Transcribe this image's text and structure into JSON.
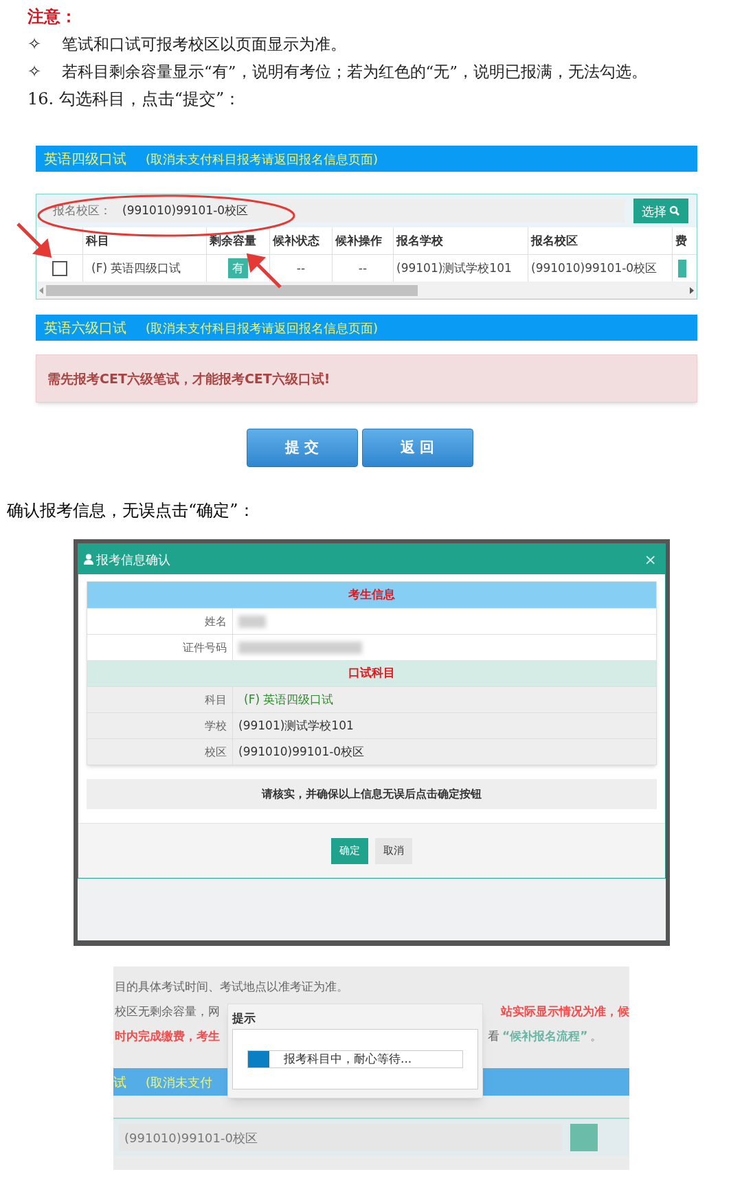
{
  "notes": {
    "heading": "注意：",
    "bullets": [
      {
        "marker": "✧",
        "text": "笔试和口试可报考校区以页面显示为准。"
      },
      {
        "marker": "✧",
        "text": "若科目剩余容量显示“有”，说明有考位；若为红色的“无”，说明已报满，无法勾选。"
      }
    ],
    "step": "16. 勾选科目，点击“提交”："
  },
  "registration": {
    "sections": [
      {
        "kind": "table",
        "title": "英语四级口试",
        "hint": "(取消未支付科目报考请返回报名信息页面)",
        "campus_label": "报名校区：",
        "campus_value": "(991010)99101-0校区",
        "select_button": "选择",
        "columns": [
          "科目",
          "剩余容量",
          "候补状态",
          "候补操作",
          "报名学校",
          "报名校区",
          "费"
        ],
        "rows": [
          {
            "checked": false,
            "subject": "(F) 英语四级口试",
            "capacity": "有",
            "wait_status": "--",
            "wait_action": "--",
            "school": "(99101)测试学校101",
            "campus": "(991010)99101-0校区"
          }
        ]
      },
      {
        "kind": "alert",
        "title": "英语六级口试",
        "hint": "(取消未支付科目报考请返回报名信息页面)",
        "alert": "需先报考CET六级笔试，才能报考CET六级口试!"
      }
    ],
    "buttons": [
      "提 交",
      "返 回"
    ]
  },
  "step_2": "确认报考信息，无误点击“确定”：",
  "dialog": {
    "title": "报考信息确认",
    "close": "×",
    "sections": [
      {
        "heading": "考生信息",
        "rows": [
          {
            "label": "姓名",
            "kind": "redacted"
          },
          {
            "label": "证件号码",
            "kind": "redacted"
          }
        ]
      },
      {
        "heading": "口试科目",
        "rows": [
          {
            "label": "科目",
            "kind": "text",
            "value": "(F) 英语四级口试"
          },
          {
            "label": "学校",
            "kind": "text",
            "value": "(99101)测试学校101"
          },
          {
            "label": "校区",
            "kind": "text",
            "value": "(991010)99101-0校区"
          }
        ]
      }
    ],
    "notice": "请核实，并确保以上信息无误后点击确定按钮",
    "buttons": [
      {
        "label": "确定",
        "primary": true
      },
      {
        "label": "取消",
        "primary": false
      }
    ]
  },
  "background_page": {
    "line_1": "目的具体考试时间、考试地点以准考证为准。",
    "line_2_left": "校区无剩余容量，网",
    "line_2_right": "站实际显示情况为准，候",
    "line_3_left": "时内完成缴费，考生",
    "line_3_right": "看",
    "line_3_link": "“候补报名流程”",
    "line_3_end": "。",
    "bar_title": "试",
    "bar_hint": "(取消未支付",
    "campus_value": "(991010)99101-0校区"
  },
  "progress_dialog": {
    "title": "提示",
    "message": "报考科目中，耐心等待...",
    "level": 0.1
  }
}
